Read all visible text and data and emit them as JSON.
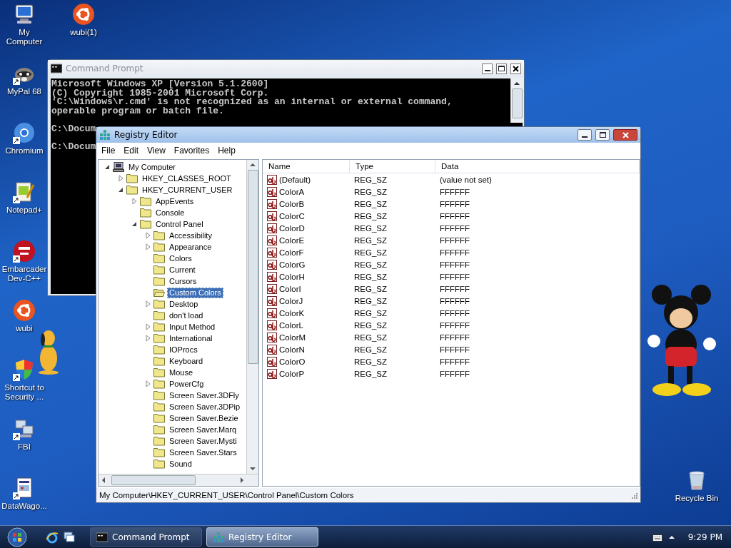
{
  "desktop": {
    "left_column": [
      {
        "label": "My Computer",
        "kind": "computer",
        "shortcut": false
      },
      {
        "label": "MyPal 68",
        "kind": "raccoon",
        "shortcut": true
      },
      {
        "label": "Chromium",
        "kind": "browser",
        "shortcut": true
      },
      {
        "label": "Notepad+",
        "kind": "notepad",
        "shortcut": true
      },
      {
        "label": "Embarcader Dev-C++",
        "kind": "dev",
        "shortcut": true
      },
      {
        "label": "wubi",
        "kind": "ubuntu",
        "shortcut": false
      },
      {
        "label": "Shortcut to Security ...",
        "kind": "shield",
        "shortcut": true
      },
      {
        "label": "FBI",
        "kind": "network",
        "shortcut": true
      },
      {
        "label": "DataWago...",
        "kind": "document",
        "shortcut": true
      }
    ],
    "second_column": [
      {
        "label": "wubi(1)",
        "kind": "ubuntu",
        "shortcut": false
      }
    ],
    "right_column": [
      {
        "label": "Recycle Bin",
        "kind": "bin",
        "shortcut": false
      }
    ]
  },
  "command_prompt": {
    "title": "Command Prompt",
    "active": false,
    "blocks": [
      [
        "Microsoft Windows XP [Version 5.1.2600]",
        "(C) Copyright 1985-2001 Microsoft Corp.",
        "'C:\\Windows\\r.cmd' is not recognized as an internal or external command,",
        "operable program or batch file."
      ],
      [
        "C:\\Docum"
      ],
      [
        "C:\\Docum"
      ]
    ]
  },
  "registry_editor": {
    "title": "Registry Editor",
    "active": true,
    "menu": [
      "File",
      "Edit",
      "View",
      "Favorites",
      "Help"
    ],
    "tree": [
      {
        "label": "My Computer",
        "kind": "computer",
        "has_children": true,
        "expanded": true,
        "selected": false,
        "children": [
          {
            "label": "HKEY_CLASSES_ROOT",
            "kind": "folder",
            "has_children": true,
            "expanded": false,
            "selected": false
          },
          {
            "label": "HKEY_CURRENT_USER",
            "kind": "folder",
            "has_children": true,
            "expanded": true,
            "selected": false,
            "children": [
              {
                "label": "AppEvents",
                "kind": "folder",
                "has_children": true,
                "expanded": false,
                "selected": false
              },
              {
                "label": "Console",
                "kind": "folder",
                "has_children": false,
                "expanded": false,
                "selected": false
              },
              {
                "label": "Control Panel",
                "kind": "folder",
                "has_children": true,
                "expanded": true,
                "selected": false,
                "children": [
                  {
                    "label": "Accessibility",
                    "kind": "folder",
                    "has_children": true,
                    "expanded": false,
                    "selected": false
                  },
                  {
                    "label": "Appearance",
                    "kind": "folder",
                    "has_children": true,
                    "expanded": false,
                    "selected": false
                  },
                  {
                    "label": "Colors",
                    "kind": "folder",
                    "has_children": false,
                    "expanded": false,
                    "selected": false
                  },
                  {
                    "label": "Current",
                    "kind": "folder",
                    "has_children": false,
                    "expanded": false,
                    "selected": false
                  },
                  {
                    "label": "Cursors",
                    "kind": "folder",
                    "has_children": false,
                    "expanded": false,
                    "selected": false
                  },
                  {
                    "label": "Custom Colors",
                    "kind": "folder",
                    "has_children": false,
                    "expanded": false,
                    "selected": true
                  },
                  {
                    "label": "Desktop",
                    "kind": "folder",
                    "has_children": true,
                    "expanded": false,
                    "selected": false
                  },
                  {
                    "label": "don't load",
                    "kind": "folder",
                    "has_children": false,
                    "expanded": false,
                    "selected": false
                  },
                  {
                    "label": "Input Method",
                    "kind": "folder",
                    "has_children": true,
                    "expanded": false,
                    "selected": false
                  },
                  {
                    "label": "International",
                    "kind": "folder",
                    "has_children": true,
                    "expanded": false,
                    "selected": false
                  },
                  {
                    "label": "IOProcs",
                    "kind": "folder",
                    "has_children": false,
                    "expanded": false,
                    "selected": false
                  },
                  {
                    "label": "Keyboard",
                    "kind": "folder",
                    "has_children": false,
                    "expanded": false,
                    "selected": false
                  },
                  {
                    "label": "Mouse",
                    "kind": "folder",
                    "has_children": false,
                    "expanded": false,
                    "selected": false
                  },
                  {
                    "label": "PowerCfg",
                    "kind": "folder",
                    "has_children": true,
                    "expanded": false,
                    "selected": false
                  },
                  {
                    "label": "Screen Saver.3DFly",
                    "kind": "folder",
                    "has_children": false,
                    "expanded": false,
                    "selected": false
                  },
                  {
                    "label": "Screen Saver.3DPip",
                    "kind": "folder",
                    "has_children": false,
                    "expanded": false,
                    "selected": false
                  },
                  {
                    "label": "Screen Saver.Bezie",
                    "kind": "folder",
                    "has_children": false,
                    "expanded": false,
                    "selected": false
                  },
                  {
                    "label": "Screen Saver.Marq",
                    "kind": "folder",
                    "has_children": false,
                    "expanded": false,
                    "selected": false
                  },
                  {
                    "label": "Screen Saver.Mysti",
                    "kind": "folder",
                    "has_children": false,
                    "expanded": false,
                    "selected": false
                  },
                  {
                    "label": "Screen Saver.Stars",
                    "kind": "folder",
                    "has_children": false,
                    "expanded": false,
                    "selected": false
                  },
                  {
                    "label": "Sound",
                    "kind": "folder",
                    "has_children": false,
                    "expanded": false,
                    "selected": false
                  }
                ]
              }
            ]
          }
        ]
      }
    ],
    "columns": [
      "Name",
      "Type",
      "Data"
    ],
    "values": [
      {
        "name": "(Default)",
        "type": "REG_SZ",
        "data": "(value not set)"
      },
      {
        "name": "ColorA",
        "type": "REG_SZ",
        "data": "FFFFFF"
      },
      {
        "name": "ColorB",
        "type": "REG_SZ",
        "data": "FFFFFF"
      },
      {
        "name": "ColorC",
        "type": "REG_SZ",
        "data": "FFFFFF"
      },
      {
        "name": "ColorD",
        "type": "REG_SZ",
        "data": "FFFFFF"
      },
      {
        "name": "ColorE",
        "type": "REG_SZ",
        "data": "FFFFFF"
      },
      {
        "name": "ColorF",
        "type": "REG_SZ",
        "data": "FFFFFF"
      },
      {
        "name": "ColorG",
        "type": "REG_SZ",
        "data": "FFFFFF"
      },
      {
        "name": "ColorH",
        "type": "REG_SZ",
        "data": "FFFFFF"
      },
      {
        "name": "ColorI",
        "type": "REG_SZ",
        "data": "FFFFFF"
      },
      {
        "name": "ColorJ",
        "type": "REG_SZ",
        "data": "FFFFFF"
      },
      {
        "name": "ColorK",
        "type": "REG_SZ",
        "data": "FFFFFF"
      },
      {
        "name": "ColorL",
        "type": "REG_SZ",
        "data": "FFFFFF"
      },
      {
        "name": "ColorM",
        "type": "REG_SZ",
        "data": "FFFFFF"
      },
      {
        "name": "ColorN",
        "type": "REG_SZ",
        "data": "FFFFFF"
      },
      {
        "name": "ColorO",
        "type": "REG_SZ",
        "data": "FFFFFF"
      },
      {
        "name": "ColorP",
        "type": "REG_SZ",
        "data": "FFFFFF"
      }
    ],
    "status_bar": "My Computer\\HKEY_CURRENT_USER\\Control Panel\\Custom Colors"
  },
  "taskbar": {
    "tasks": [
      {
        "label": "Command Prompt",
        "kind": "console",
        "selected": false
      },
      {
        "label": "Registry Editor",
        "kind": "registry",
        "selected": true
      }
    ],
    "clock": "9:29 PM"
  }
}
